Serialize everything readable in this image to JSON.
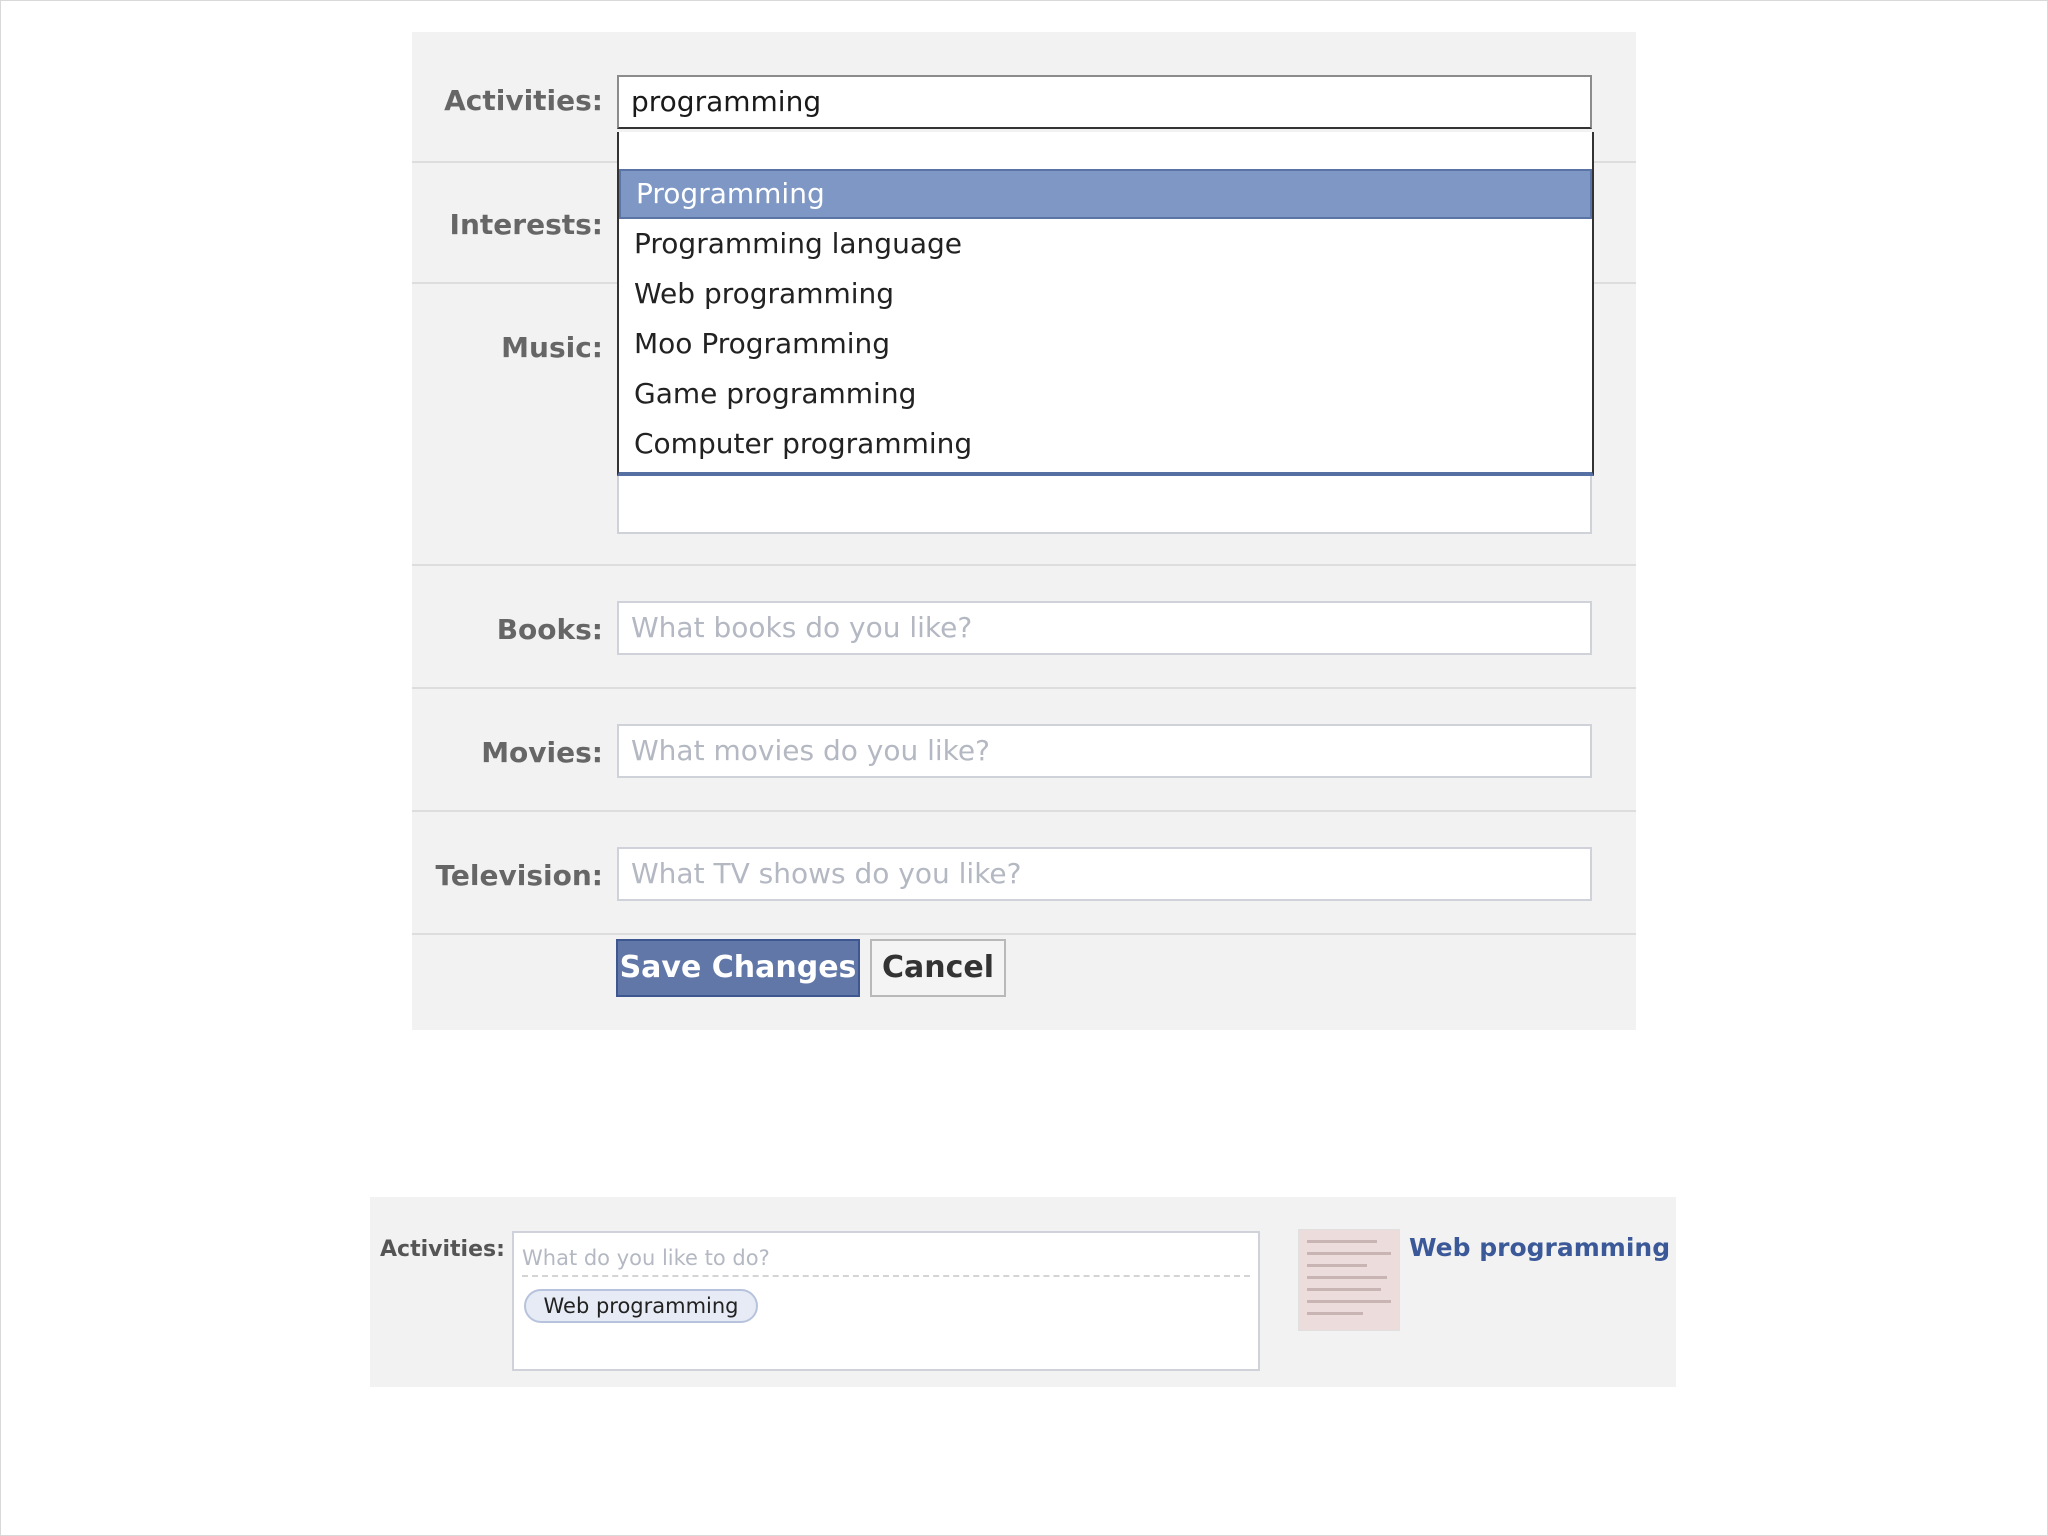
{
  "form": {
    "activities": {
      "label": "Activities:",
      "value": "programming"
    },
    "interests": {
      "label": "Interests:"
    },
    "music": {
      "label": "Music:"
    },
    "books": {
      "label": "Books:",
      "placeholder": "What books do you like?"
    },
    "movies": {
      "label": "Movies:",
      "placeholder": "What movies do you like?"
    },
    "television": {
      "label": "Television:",
      "placeholder": "What TV shows do you like?"
    }
  },
  "suggestions": [
    "Programming",
    "Programming language",
    "Web programming",
    "Moo Programming",
    "Game programming",
    "Computer programming"
  ],
  "buttons": {
    "save": "Save Changes",
    "cancel": "Cancel"
  },
  "result": {
    "label": "Activities:",
    "placeholder": "What do you like to do?",
    "token": "Web programming",
    "page_link": "Web programming"
  },
  "colors": {
    "highlight": "#7e97c4",
    "button_blue": "#6077a8",
    "link": "#3b5998"
  }
}
